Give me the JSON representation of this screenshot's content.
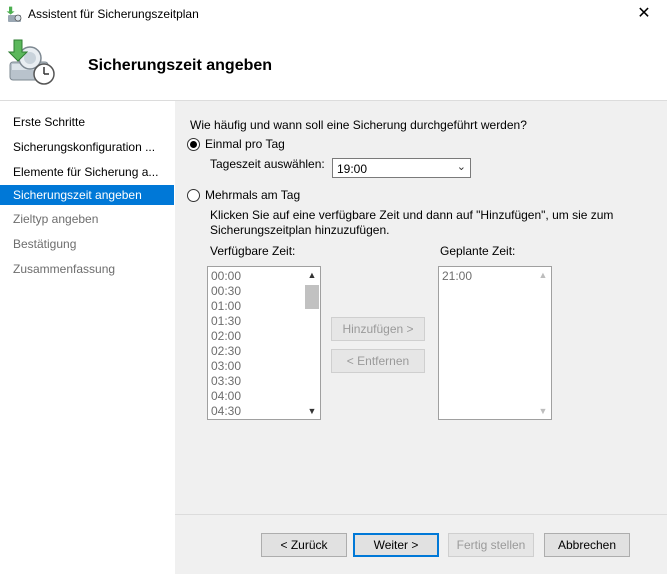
{
  "window": {
    "title": "Assistent für Sicherungszeitplan",
    "close_glyph": "✕"
  },
  "header": {
    "title": "Sicherungszeit angeben",
    "icon": "backup-clock-icon"
  },
  "sidebar": {
    "items": [
      {
        "label": "Erste Schritte",
        "state": "normal"
      },
      {
        "label": "Sicherungskonfiguration ...",
        "state": "normal"
      },
      {
        "label": "Elemente für Sicherung a...",
        "state": "normal"
      },
      {
        "label": "Sicherungszeit angeben",
        "state": "active"
      },
      {
        "label": "Zieltyp angeben",
        "state": "disabled"
      },
      {
        "label": "Bestätigung",
        "state": "disabled"
      },
      {
        "label": "Zusammenfassung",
        "state": "disabled"
      }
    ]
  },
  "main": {
    "question": "Wie häufig und wann soll eine Sicherung durchgeführt werden?",
    "option_once": "Einmal pro Tag",
    "time_label": "Tageszeit auswählen:",
    "time_value": "19:00",
    "option_multiple": "Mehrmals am Tag",
    "instructions_line1": "Klicken Sie auf eine verfügbare Zeit und dann auf \"Hinzufügen\", um sie zum",
    "instructions_line2": "Sicherungszeitplan hinzuzufügen.",
    "available_label": "Verfügbare Zeit:",
    "available_times": [
      "00:00",
      "00:30",
      "01:00",
      "01:30",
      "02:00",
      "02:30",
      "03:00",
      "03:30",
      "04:00",
      "04:30"
    ],
    "add_button": "Hinzufügen >",
    "remove_button": "< Entfernen",
    "scheduled_label": "Geplante Zeit:",
    "scheduled_times": [
      "21:00"
    ],
    "selected_option": "once"
  },
  "footer": {
    "back": "< Zurück",
    "next": "Weiter >",
    "finish": "Fertig stellen",
    "cancel": "Abbrechen"
  },
  "colors": {
    "accent": "#0078d7",
    "pane": "#f0f0f0"
  }
}
